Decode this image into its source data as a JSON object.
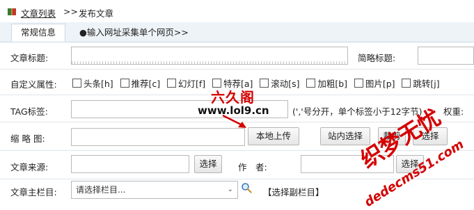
{
  "breadcrumb": {
    "link": "文章列表",
    "separator": ">>",
    "current": "发布文章"
  },
  "tabs": {
    "general": "常规信息",
    "collect": "●输入网址采集单个网页>>"
  },
  "row_title": {
    "label": "文章标题:",
    "short_label": "简略标题:"
  },
  "row_attrs": {
    "label": "自定义属性:",
    "items": [
      "头条[h]",
      "推荐[c]",
      "幻灯[f]",
      "特荐[a]",
      "滚动[s]",
      "加粗[b]",
      "图片[p]",
      "跳转[j]"
    ]
  },
  "row_tag": {
    "label": "TAG标签:",
    "hint": "(','号分开，单个标签小于12字节)",
    "weight_label": "权重:"
  },
  "row_thumb": {
    "label": "缩 略 图:",
    "upload": "本地上传",
    "site_select": "站内选择",
    "crop": "裁剪",
    "select": "选择"
  },
  "row_source": {
    "label": "文章来源:",
    "select": "选择",
    "author_label": "作　者:",
    "author_select": "选择"
  },
  "row_category": {
    "label": "文章主栏目:",
    "select_value": "请选择栏目...",
    "sub_link": "【选择副栏目】"
  },
  "watermarks": {
    "logo": "六久阁",
    "url": "www.lol9.cn",
    "stamp": "织梦无忧",
    "domain": "dedecms51.com"
  },
  "colors": {
    "watermark": "#d40000",
    "tab_bg": "#eef3f7",
    "border": "#c9d8e5"
  }
}
